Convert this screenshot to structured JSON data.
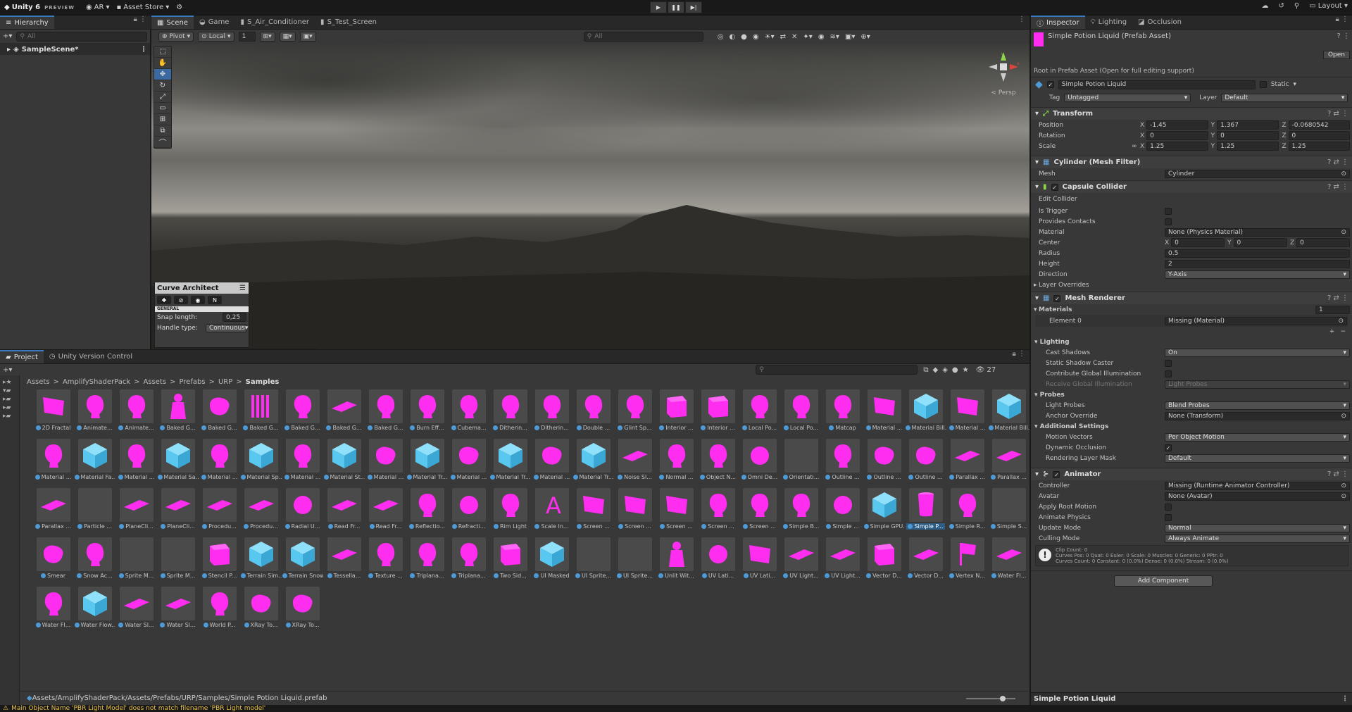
{
  "toolbar": {
    "logo": "Unity 6",
    "logo_sub": "PREVIEW",
    "account": "AR",
    "asset_store": "Asset Store",
    "layout": "Layout"
  },
  "hierarchy": {
    "tab": "Hierarchy",
    "search_placeholder": "All",
    "scene": "SampleScene*"
  },
  "scene_tabs": [
    "Scene",
    "Game",
    "S_Air_Conditioner",
    "S_Test_Screen"
  ],
  "scene_toolbar": {
    "pivot": "Pivot",
    "local": "Local",
    "grid": "1",
    "search_placeholder": "All"
  },
  "gizmo": {
    "persp": "Persp"
  },
  "curve_architect": {
    "title": "Curve Architect",
    "section": "GENERAL",
    "snap_label": "Snap length:",
    "snap_value": "0,25",
    "handle_label": "Handle type:",
    "handle_value": "Continuous"
  },
  "project": {
    "tabs": [
      "Project",
      "Unity Version Control"
    ],
    "breadcrumb": [
      "Assets",
      "AmplifyShaderPack",
      "Assets",
      "Prefabs",
      "URP",
      "Samples"
    ],
    "count": "27",
    "path": "Assets/AmplifyShaderPack/Assets/Prefabs/URP/Samples/Simple Potion Liquid.prefab",
    "assets": [
      {
        "label": "2D Fractal",
        "shape": "quad"
      },
      {
        "label": "Animate...",
        "shape": "head"
      },
      {
        "label": "Animate...",
        "shape": "head"
      },
      {
        "label": "Baked G...",
        "shape": "bust"
      },
      {
        "label": "Baked G...",
        "shape": "blob"
      },
      {
        "label": "Baked G...",
        "shape": "bars"
      },
      {
        "label": "Baked G...",
        "shape": "head"
      },
      {
        "label": "Baked G...",
        "shape": "plane"
      },
      {
        "label": "Baked G...",
        "shape": "head"
      },
      {
        "label": "Burn Eff...",
        "shape": "head"
      },
      {
        "label": "Cubema...",
        "shape": "head"
      },
      {
        "label": "Ditherin...",
        "shape": "head"
      },
      {
        "label": "Ditherin...",
        "shape": "head"
      },
      {
        "label": "Double ...",
        "shape": "head"
      },
      {
        "label": "Glint Sp...",
        "shape": "head"
      },
      {
        "label": "Interior ...",
        "shape": "cube"
      },
      {
        "label": "Interior ...",
        "shape": "cube"
      },
      {
        "label": "Local Po...",
        "shape": "head"
      },
      {
        "label": "Local Po...",
        "shape": "head"
      },
      {
        "label": "Matcap",
        "shape": "head"
      },
      {
        "label": "Material ...",
        "shape": "quad"
      },
      {
        "label": "Material Bill...",
        "shape": "bluecube"
      },
      {
        "label": "Material ...",
        "shape": "quad"
      },
      {
        "label": "Material Bill...",
        "shape": "bluecube"
      },
      {
        "label": "Material ...",
        "shape": "head"
      },
      {
        "label": "Material Fa...",
        "shape": "bluecube"
      },
      {
        "label": "Material ...",
        "shape": "head"
      },
      {
        "label": "Material Sa...",
        "shape": "bluecube"
      },
      {
        "label": "Material ...",
        "shape": "head"
      },
      {
        "label": "Material Sp...",
        "shape": "bluecube"
      },
      {
        "label": "Material ...",
        "shape": "head"
      },
      {
        "label": "Material St...",
        "shape": "bluecube"
      },
      {
        "label": "Material ...",
        "shape": "blob"
      },
      {
        "label": "Material Tr...",
        "shape": "bluecube"
      },
      {
        "label": "Material ...",
        "shape": "blob"
      },
      {
        "label": "Material Tr...",
        "shape": "bluecube"
      },
      {
        "label": "Material ...",
        "shape": "blob"
      },
      {
        "label": "Material Tr...",
        "shape": "bluecube"
      },
      {
        "label": "Noise Sl...",
        "shape": "plane"
      },
      {
        "label": "Normal ...",
        "shape": "head"
      },
      {
        "label": "Object N...",
        "shape": "head"
      },
      {
        "label": "Omni De...",
        "shape": "sphere"
      },
      {
        "label": "Orientati...",
        "shape": "empty"
      },
      {
        "label": "Outline ...",
        "shape": "head"
      },
      {
        "label": "Outline ...",
        "shape": "blob"
      },
      {
        "label": "Outline ...",
        "shape": "blob"
      },
      {
        "label": "Parallax ...",
        "shape": "plane"
      },
      {
        "label": "Parallax ...",
        "shape": "plane"
      },
      {
        "label": "Parallax ...",
        "shape": "plane"
      },
      {
        "label": "Particle ...",
        "shape": "empty"
      },
      {
        "label": "PlaneCli...",
        "shape": "plane"
      },
      {
        "label": "PlaneCli...",
        "shape": "plane"
      },
      {
        "label": "Procedu...",
        "shape": "plane"
      },
      {
        "label": "Procedu...",
        "shape": "plane"
      },
      {
        "label": "Radial U...",
        "shape": "sphere"
      },
      {
        "label": "Read Fr...",
        "shape": "plane"
      },
      {
        "label": "Read Fr...",
        "shape": "plane"
      },
      {
        "label": "Reflectio...",
        "shape": "head"
      },
      {
        "label": "Refracti...",
        "shape": "sphere"
      },
      {
        "label": "Rim Light",
        "shape": "head"
      },
      {
        "label": "Scale In...",
        "shape": "letter"
      },
      {
        "label": "Screen ...",
        "shape": "quad"
      },
      {
        "label": "Screen ...",
        "shape": "quad"
      },
      {
        "label": "Screen ...",
        "shape": "quad"
      },
      {
        "label": "Screen ...",
        "shape": "head"
      },
      {
        "label": "Screen ...",
        "shape": "head"
      },
      {
        "label": "Simple B...",
        "shape": "head"
      },
      {
        "label": "Simple ...",
        "shape": "sphere"
      },
      {
        "label": "Simple GPU...",
        "shape": "bluecube"
      },
      {
        "label": "Simple P...",
        "shape": "cyl",
        "selected": true
      },
      {
        "label": "Simple R...",
        "shape": "head"
      },
      {
        "label": "Simple S...",
        "shape": "empty"
      },
      {
        "label": "Smear",
        "shape": "blob"
      },
      {
        "label": "Snow Ac...",
        "shape": "head"
      },
      {
        "label": "Sprite M...",
        "shape": "empty"
      },
      {
        "label": "Sprite M...",
        "shape": "empty"
      },
      {
        "label": "Stencil P...",
        "shape": "cube"
      },
      {
        "label": "Terrain Sim...",
        "shape": "bluecube"
      },
      {
        "label": "Terrain Snow",
        "shape": "bluecube"
      },
      {
        "label": "Tessella...",
        "shape": "plane"
      },
      {
        "label": "Texture ...",
        "shape": "head"
      },
      {
        "label": "Triplana...",
        "shape": "head"
      },
      {
        "label": "Triplana...",
        "shape": "head"
      },
      {
        "label": "Two Sid...",
        "shape": "cube"
      },
      {
        "label": "UI Masked",
        "shape": "bluecube"
      },
      {
        "label": "UI Sprite...",
        "shape": "empty"
      },
      {
        "label": "UI Sprite...",
        "shape": "empty"
      },
      {
        "label": "Unlit Wit...",
        "shape": "bust"
      },
      {
        "label": "UV Lati...",
        "shape": "sphere"
      },
      {
        "label": "UV Lati...",
        "shape": "quad"
      },
      {
        "label": "UV Light...",
        "shape": "plane"
      },
      {
        "label": "UV Light...",
        "shape": "plane"
      },
      {
        "label": "Vector D...",
        "shape": "cube"
      },
      {
        "label": "Vector D...",
        "shape": "plane"
      },
      {
        "label": "Vertex N...",
        "shape": "flag"
      },
      {
        "label": "Water Fl...",
        "shape": "plane"
      },
      {
        "label": "Water Fl...",
        "shape": "head"
      },
      {
        "label": "Water Flow...",
        "shape": "bluecube"
      },
      {
        "label": "Water Sl...",
        "shape": "plane"
      },
      {
        "label": "Water Sl...",
        "shape": "plane"
      },
      {
        "label": "World P...",
        "shape": "head"
      },
      {
        "label": "XRay To...",
        "shape": "blob"
      },
      {
        "label": "XRay To...",
        "shape": "blob"
      }
    ]
  },
  "inspector": {
    "tabs": [
      "Inspector",
      "Lighting",
      "Occlusion"
    ],
    "title": "Simple Potion Liquid (Prefab Asset)",
    "open": "Open",
    "note": "Root in Prefab Asset (Open for full editing support)",
    "name": "Simple Potion Liquid",
    "static": "Static",
    "tag_label": "Tag",
    "tag": "Untagged",
    "layer_label": "Layer",
    "layer": "Default",
    "transform": {
      "title": "Transform",
      "position_label": "Position",
      "px": "-1.45",
      "py": "1.367",
      "pz": "-0.0680542",
      "rotation_label": "Rotation",
      "rx": "0",
      "ry": "0",
      "rz": "0",
      "scale_label": "Scale",
      "sx": "1.25",
      "sy": "1.25",
      "sz": "1.25"
    },
    "mesh_filter": {
      "title": "Cylinder (Mesh Filter)",
      "mesh_label": "Mesh",
      "mesh": "Cylinder"
    },
    "capsule": {
      "title": "Capsule Collider",
      "edit": "Edit Collider",
      "trigger": "Is Trigger",
      "contacts": "Provides Contacts",
      "material_label": "Material",
      "material": "None (Physics Material)",
      "center_label": "Center",
      "cx": "0",
      "cy": "0",
      "cz": "0",
      "radius_label": "Radius",
      "radius": "0.5",
      "height_label": "Height",
      "height": "2",
      "direction_label": "Direction",
      "direction": "Y-Axis",
      "overrides": "Layer Overrides"
    },
    "renderer": {
      "title": "Mesh Renderer",
      "materials": "Materials",
      "mat_count": "1",
      "element": "Element 0",
      "element_value": "Missing (Material)",
      "lighting": "Lighting",
      "cast_label": "Cast Shadows",
      "cast": "On",
      "static_shadow": "Static Shadow Caster",
      "gi": "Contribute Global Illumination",
      "receive_label": "Receive Global Illumination",
      "receive": "Light Probes",
      "probes": "Probes",
      "light_probes_label": "Light Probes",
      "light_probes": "Blend Probes",
      "anchor_label": "Anchor Override",
      "anchor": "None (Transform)",
      "additional": "Additional Settings",
      "motion_label": "Motion Vectors",
      "motion": "Per Object Motion",
      "dynamic": "Dynamic Occlusion",
      "mask_label": "Rendering Layer Mask",
      "mask": "Default"
    },
    "animator": {
      "title": "Animator",
      "controller_label": "Controller",
      "controller": "Missing (Runtime Animator Controller)",
      "avatar_label": "Avatar",
      "avatar": "None (Avatar)",
      "root_motion": "Apply Root Motion",
      "physics": "Animate Physics",
      "update_label": "Update Mode",
      "update": "Normal",
      "culling_label": "Culling Mode",
      "culling": "Always Animate",
      "info1": "Clip Count: 0",
      "info2": "Curves Pos: 0 Quat: 0 Euler: 0 Scale: 0 Muscles: 0 Generic: 0 PPtr: 0",
      "info3": "Curves Count: 0 Constant: 0 (0.0%) Dense: 0 (0.0%) Stream: 0 (0.0%)"
    },
    "add_component": "Add Component",
    "footer": "Simple Potion Liquid"
  },
  "status": "Main Object Name 'PBR Light Model' does not match filename 'PBR Light model'",
  "colors": {
    "magenta": "#ff2df0",
    "cyan": "#58c8f0",
    "accent": "#3a79bb"
  }
}
